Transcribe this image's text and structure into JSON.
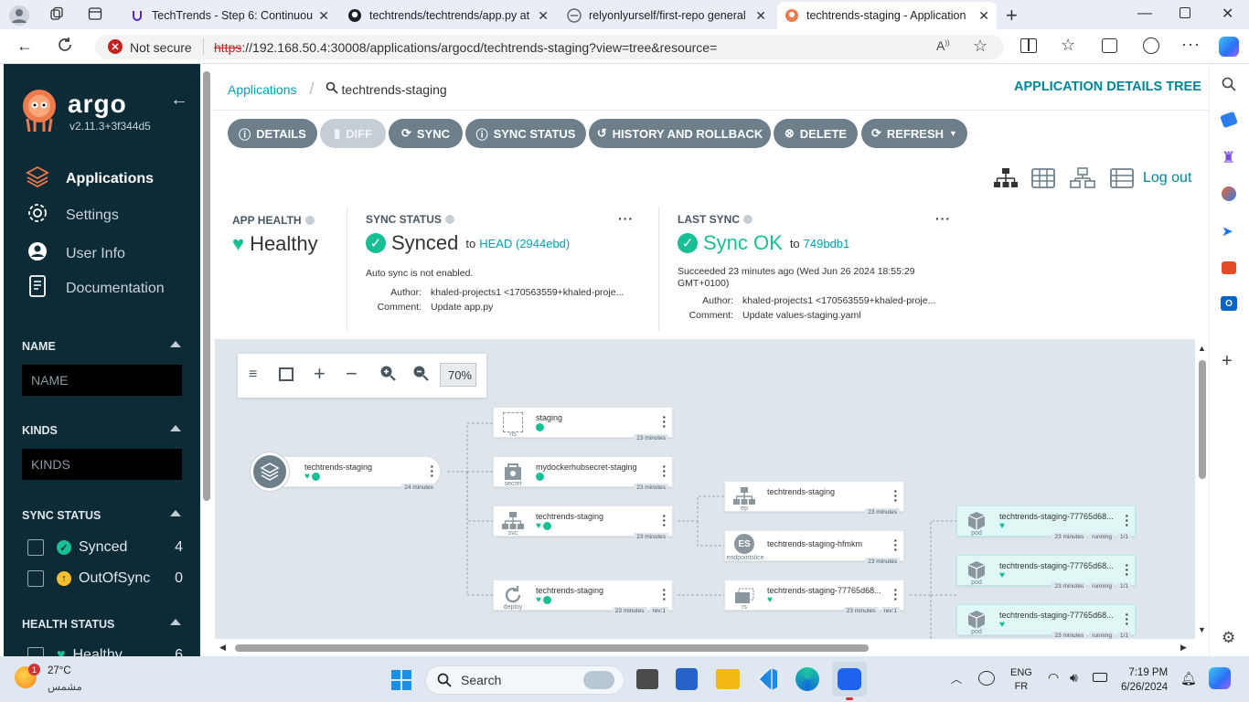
{
  "browser": {
    "tabs": [
      {
        "title": "TechTrends - Step 6: Continuous",
        "icon": "udemy-icon",
        "color": "#5624d0"
      },
      {
        "title": "techtrends/techtrends/app.py at",
        "icon": "github-icon",
        "color": "#1f2328"
      },
      {
        "title": "relyonlyurself/first-repo general",
        "icon": "gitter-icon",
        "color": "#6b6b6b"
      },
      {
        "title": "techtrends-staging - Application",
        "icon": "argo-icon",
        "color": "#ef7b4d",
        "active": true
      }
    ],
    "security": "Not secure",
    "url_scheme": "https",
    "url_rest": "://192.168.50.4:30008/applications/argocd/techtrends-staging?view=tree&resource="
  },
  "sidebar": {
    "brand": "argo",
    "version": "v2.11.3+3f344d5",
    "nav": [
      {
        "label": "Applications",
        "icon": "layers-icon",
        "active": true
      },
      {
        "label": "Settings",
        "icon": "gear-icon"
      },
      {
        "label": "User Info",
        "icon": "user-icon"
      },
      {
        "label": "Documentation",
        "icon": "document-icon"
      }
    ],
    "name_section": "NAME",
    "name_placeholder": "NAME",
    "kinds_section": "KINDS",
    "kinds_placeholder": "KINDS",
    "sync_section": "SYNC STATUS",
    "sync_items": [
      {
        "label": "Synced",
        "count": "4",
        "icon": "check-circle-icon",
        "color": "#18be94"
      },
      {
        "label": "OutOfSync",
        "count": "0",
        "icon": "arrow-up-circle-icon",
        "color": "#f4c030"
      }
    ],
    "health_section": "HEALTH STATUS",
    "health_first": "Healthy",
    "health_count": "6"
  },
  "header": {
    "breadcrumb_link": "Applications",
    "breadcrumb_current": "techtrends-staging",
    "page_title": "APPLICATION DETAILS TREE",
    "logout": "Log out"
  },
  "toolbar": {
    "details": "DETAILS",
    "diff": "DIFF",
    "sync": "SYNC",
    "sync_status": "SYNC STATUS",
    "history": "HISTORY AND ROLLBACK",
    "delete": "DELETE",
    "refresh": "REFRESH"
  },
  "status": {
    "app_health_label": "APP HEALTH",
    "app_health": "Healthy",
    "sync_status_label": "SYNC STATUS",
    "sync_status": "Synced",
    "sync_to": "to",
    "sync_rev": "HEAD (2944ebd)",
    "auto_sync": "Auto sync is not enabled.",
    "author_label": "Author:",
    "author": "khaled-projects1 <170563559+khaled-proje...",
    "comment_label": "Comment:",
    "comment": "Update app.py",
    "last_sync_label": "LAST SYNC",
    "last_sync": "Sync OK",
    "last_sync_to": "to",
    "last_sync_rev": "749bdb1",
    "succeeded": "Succeeded 23 minutes ago (Wed Jun 26 2024 18:55:29 GMT+0100)",
    "last_author": "khaled-projects1 <170563559+khaled-proje...",
    "last_comment": "Update values-staging.yaml"
  },
  "graph": {
    "zoom": "70%",
    "root": {
      "name": "techtrends-staging",
      "age": "24 minutes"
    },
    "nodes": [
      {
        "name": "staging",
        "kind": "ns",
        "age": "23 minutes"
      },
      {
        "name": "mydockerhubsecret-staging",
        "kind": "secret",
        "age": "23 minutes"
      },
      {
        "name": "techtrends-staging",
        "kind": "svc",
        "age": "23 minutes"
      },
      {
        "name": "techtrends-staging",
        "kind": "deploy",
        "age": "23 minutes",
        "rev": "rev:1"
      },
      {
        "name": "techtrends-staging",
        "kind": "ep",
        "age": "23 minutes"
      },
      {
        "name": "techtrends-staging-hfmkm",
        "kind": "endpointslice",
        "badge": "ES",
        "age": "23 minutes"
      },
      {
        "name": "techtrends-staging-77765d68...",
        "kind": "rs",
        "age": "23 minutes",
        "rev": "rev:1"
      },
      {
        "name": "techtrends-staging-77765d68...",
        "kind": "pod",
        "age": "23 minutes",
        "state": "running",
        "ready": "1/1"
      },
      {
        "name": "techtrends-staging-77765d68...",
        "kind": "pod",
        "age": "23 minutes",
        "state": "running",
        "ready": "1/1"
      },
      {
        "name": "techtrends-staging-77765d68...",
        "kind": "pod",
        "age": "23 minutes",
        "state": "running",
        "ready": "1/1"
      }
    ]
  },
  "taskbar": {
    "temp": "27°C",
    "weather": "مشمس",
    "search": "Search",
    "lang1": "ENG",
    "lang2": "FR",
    "time": "7:19 PM",
    "date": "6/26/2024",
    "weather_badge": "1"
  },
  "colors": {
    "sidebar": "#0d2b37",
    "accent": "#18be94",
    "teal": "#00a2b3",
    "button": "#6d7f8b"
  }
}
